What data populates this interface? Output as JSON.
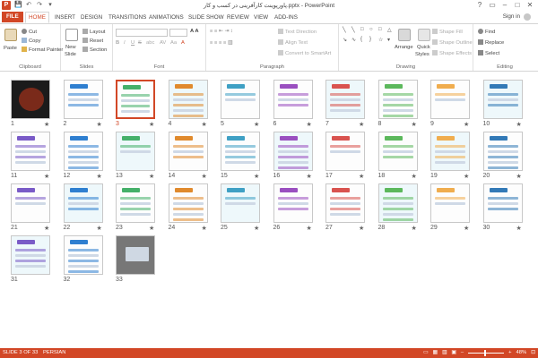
{
  "window": {
    "title": "پاورپوینت کارآفرینی در کسب و کار.pptx - PowerPoint",
    "controls": [
      "?",
      "▭",
      "–",
      "□",
      "✕"
    ]
  },
  "qat": {
    "save": "💾",
    "undo": "↶",
    "redo": "↷",
    "customize": "▾"
  },
  "tabs": [
    "FILE",
    "HOME",
    "INSERT",
    "DESIGN",
    "TRANSITIONS",
    "ANIMATIONS",
    "SLIDE SHOW",
    "REVIEW",
    "VIEW",
    "ADD-INS"
  ],
  "active_tab": "HOME",
  "signin": "Sign in",
  "ribbon": {
    "clipboard": {
      "label": "Clipboard",
      "paste": "Paste",
      "cut": "Cut",
      "copy": "Copy",
      "format_painter": "Format Painter"
    },
    "slides": {
      "label": "Slides",
      "new_slide": "New",
      "new_slide2": "Slide",
      "layout": "Layout",
      "reset": "Reset",
      "section": "Section"
    },
    "font": {
      "label": "Font",
      "font_name": "",
      "font_size": "",
      "bold": "B",
      "italic": "I",
      "underline": "U",
      "strike": "S",
      "shadow": "abc",
      "spacing": "AV",
      "case": "Aa",
      "color": "A"
    },
    "paragraph": {
      "label": "Paragraph",
      "text_direction": "Text Direction",
      "align_text": "Align Text",
      "smartart": "Convert to SmartArt"
    },
    "drawing": {
      "label": "Drawing",
      "arrange": "Arrange",
      "quick_styles": "Quick",
      "quick_styles2": "Styles",
      "shape_fill": "Shape Fill",
      "shape_outline": "Shape Outline",
      "shape_effects": "Shape Effects"
    },
    "editing": {
      "label": "Editing",
      "find": "Find",
      "replace": "Replace",
      "select": "Select"
    }
  },
  "slides": {
    "total": 33,
    "selected": 3,
    "numbers": [
      "1",
      "2",
      "3",
      "4",
      "5",
      "6",
      "7",
      "8",
      "9",
      "10",
      "11",
      "12",
      "13",
      "14",
      "15",
      "16",
      "17",
      "18",
      "19",
      "20",
      "21",
      "22",
      "23",
      "24",
      "25",
      "26",
      "27",
      "28",
      "29",
      "30",
      "31",
      "32",
      "33"
    ],
    "star": "★"
  },
  "status": {
    "slide_of": "SLIDE 3 OF 33",
    "language": "PERSIAN",
    "zoom": "48%"
  },
  "colors": {
    "accent": "#d24726"
  }
}
